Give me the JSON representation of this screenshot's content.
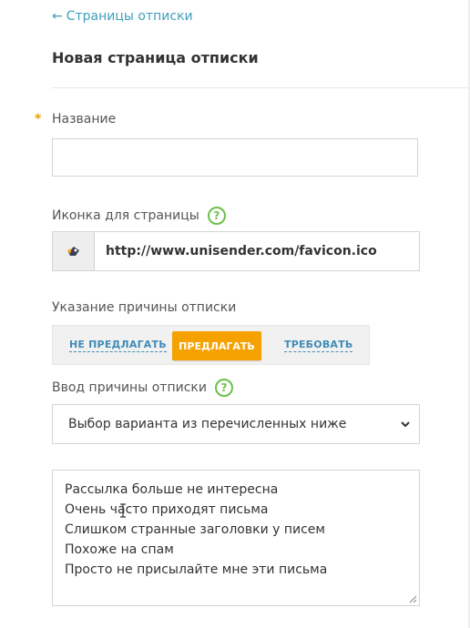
{
  "back_link": {
    "arrow": "←",
    "label": "Страницы отписки"
  },
  "page_title": "Новая страница отписки",
  "name_field": {
    "required_mark": "*",
    "label": "Название",
    "value": ""
  },
  "icon_field": {
    "label": "Иконка для страницы",
    "help": "?",
    "favicon_url": "http://www.unisender.com/favicon.ico",
    "icon": "favicon-icon"
  },
  "reason_mode": {
    "label": "Указание причины отписки",
    "options": [
      "НЕ ПРЕДЛАГАТЬ",
      "ПРЕДЛАГАТЬ",
      "ТРЕБОВАТЬ"
    ],
    "selected": "ПРЕДЛАГАТЬ",
    "accent_color": "#f5a100"
  },
  "reason_input": {
    "label": "Ввод причины отписки",
    "help": "?",
    "selected_option": "Выбор варианта из перечисленных ниже"
  },
  "reasons": [
    "Рассылка больше не интересна",
    "Очень часто приходят письма",
    "Слишком странные заголовки у писем",
    "Похоже на спам",
    "Просто не присылайте мне эти письма"
  ],
  "colors": {
    "link": "#3f9fb9",
    "help": "#6cc04a"
  }
}
